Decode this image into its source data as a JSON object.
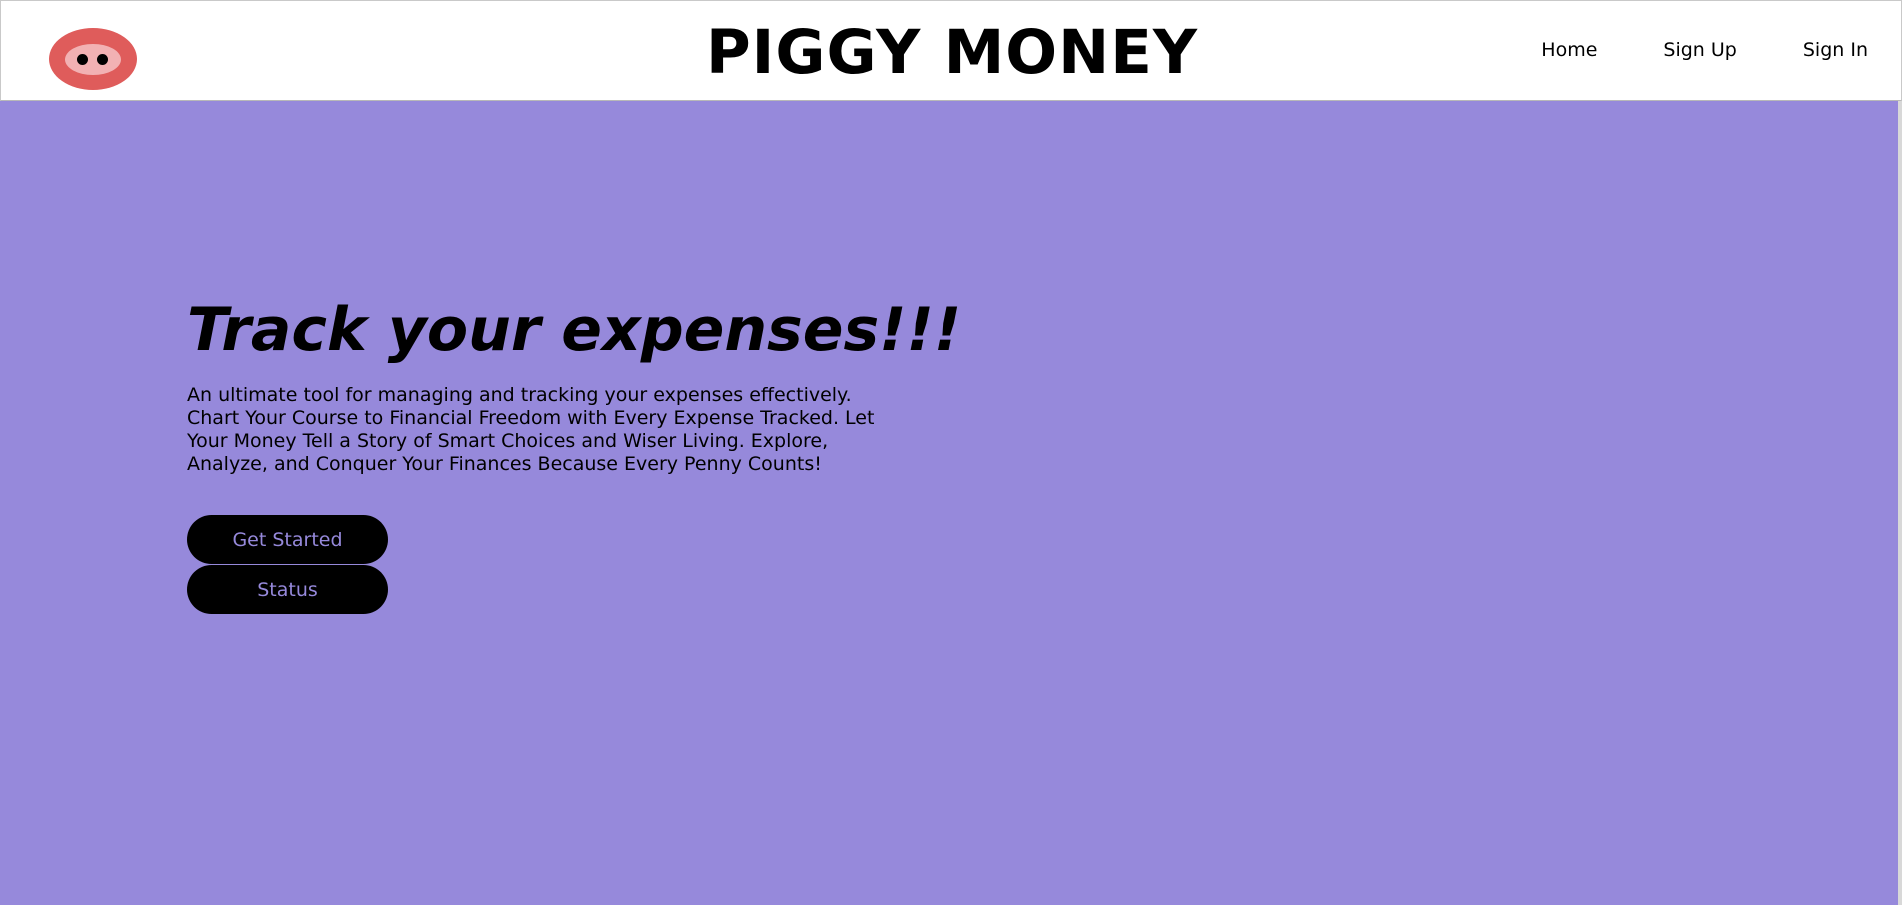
{
  "header": {
    "brand": "PIGGY MONEY",
    "nav": {
      "home": "Home",
      "sign_up": "Sign Up",
      "sign_in": "Sign In"
    }
  },
  "hero": {
    "headline": "Track your expenses!!!",
    "description": "An ultimate tool for managing and tracking your expenses effectively. Chart Your Course to Financial Freedom with Every Expense Tracked. Let Your Money Tell a Story of Smart Choices and Wiser Living. Explore, Analyze, and Conquer Your Finances Because Every Penny Counts!",
    "buttons": {
      "get_started": "Get Started",
      "status": "Status"
    }
  },
  "colors": {
    "hero_background": "#9689db",
    "logo_pig": "#df5c5b",
    "logo_snout": "#f2b1b3",
    "button_bg": "#000000",
    "button_text": "#9689db"
  },
  "icons": {
    "logo": "pig-snout-icon"
  }
}
